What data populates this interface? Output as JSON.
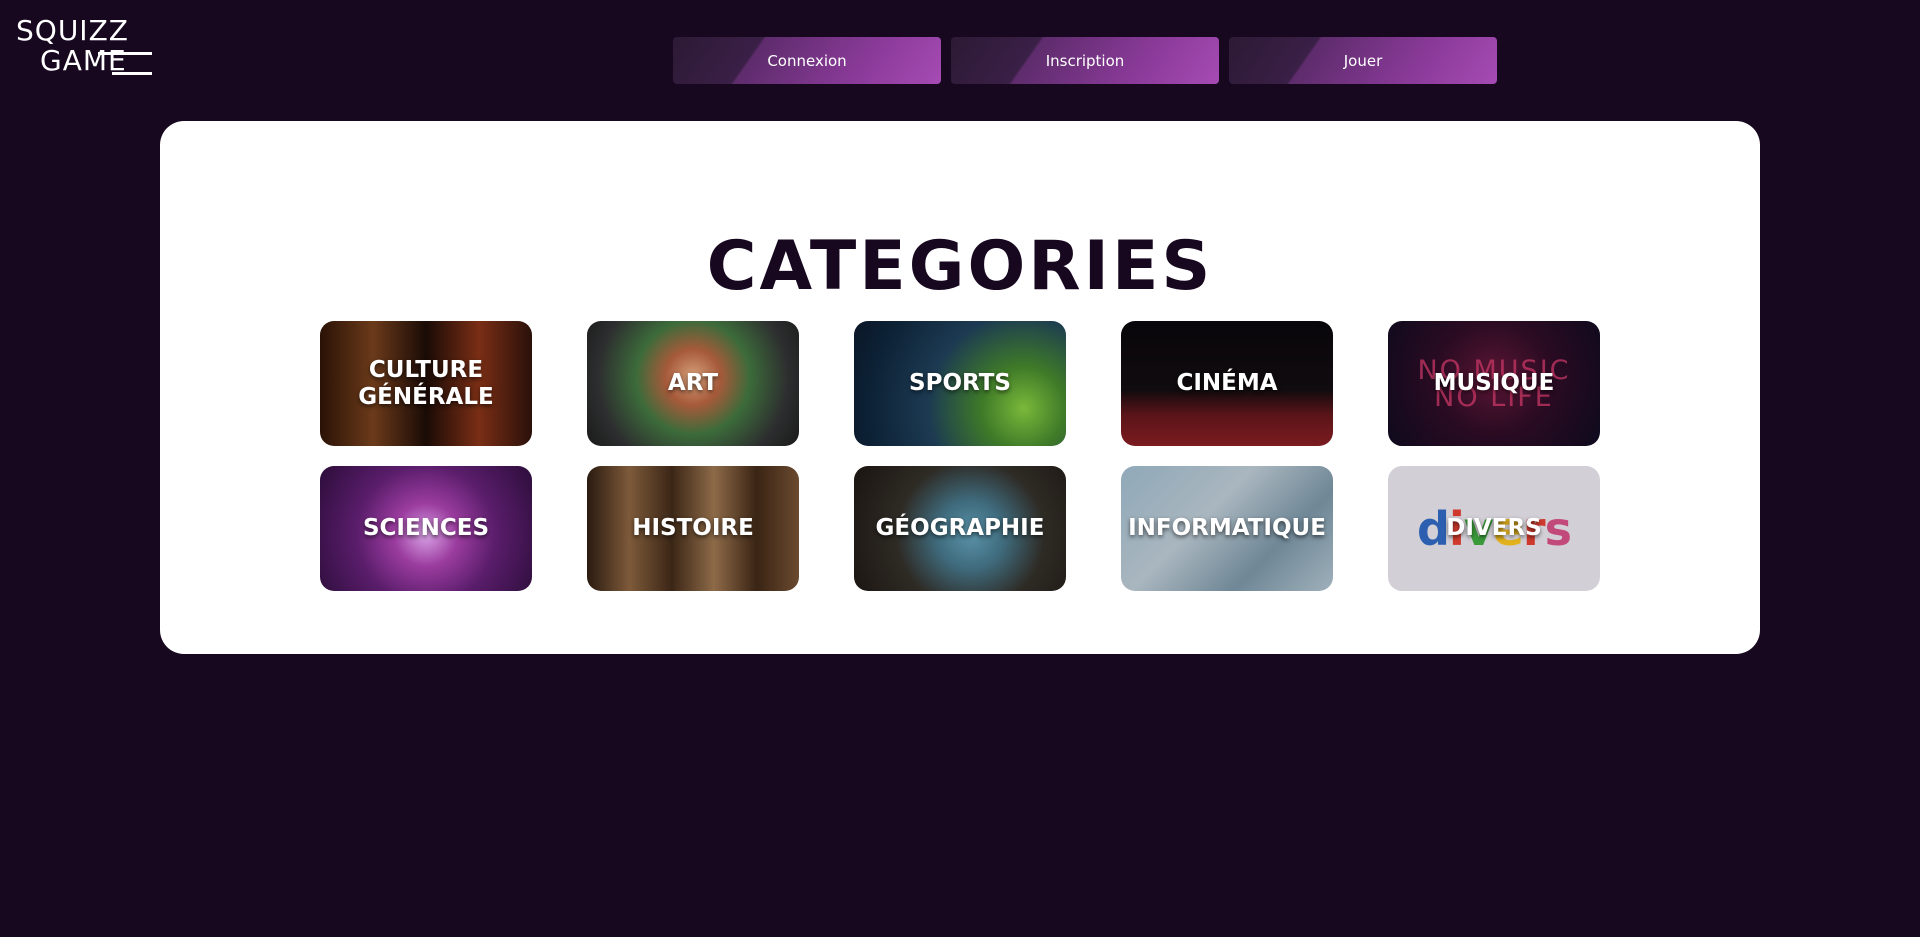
{
  "logo": {
    "line1": "SQUIZZ",
    "line2": "GAME"
  },
  "nav": [
    {
      "label": "Connexion"
    },
    {
      "label": "Inscription"
    },
    {
      "label": "Jouer"
    }
  ],
  "main": {
    "title": "CATEGORIES",
    "categories": [
      {
        "label": "CULTURE\nGÉNÉRALE"
      },
      {
        "label": "ART"
      },
      {
        "label": "SPORTS"
      },
      {
        "label": "CINÉMA"
      },
      {
        "label": "MUSIQUE",
        "neon_text": "NO MUSIC\nNO LIFE"
      },
      {
        "label": "SCIENCES"
      },
      {
        "label": "HISTOIRE"
      },
      {
        "label": "GÉOGRAPHIE"
      },
      {
        "label": "INFORMATIQUE"
      },
      {
        "label": "DIVERS",
        "image_word": "divers"
      }
    ]
  },
  "colors": {
    "background": "#170820",
    "panel": "#ffffff",
    "title": "#170820",
    "button_accent": "#a64bb4"
  }
}
